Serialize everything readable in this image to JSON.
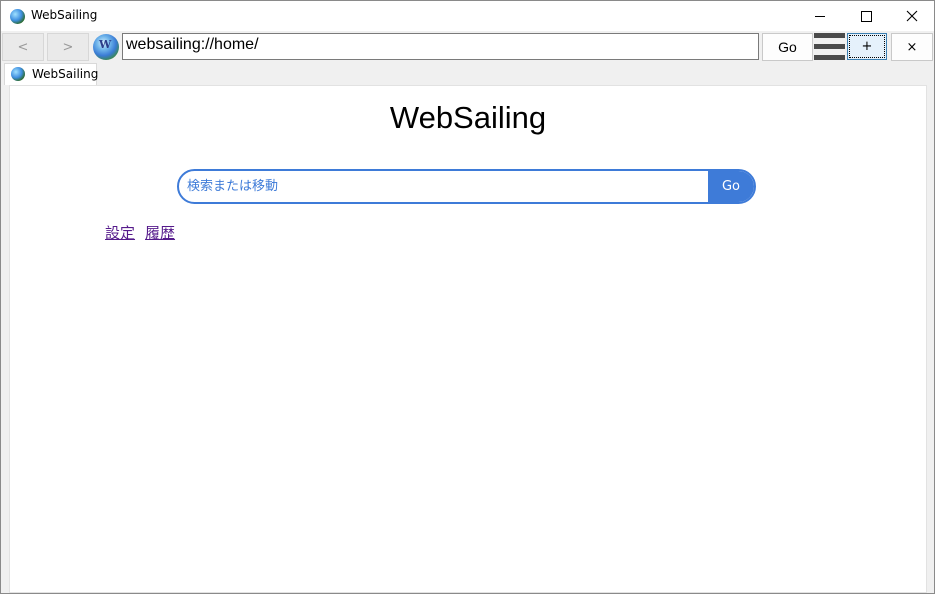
{
  "window": {
    "title": "WebSailing",
    "controls": [
      "minimize",
      "maximize",
      "close"
    ]
  },
  "toolbar": {
    "back_label": "<",
    "forward_label": ">",
    "site_icon_letter": "W",
    "address_value": "websailing://home/",
    "go_label": "Go",
    "menu_icon": "hamburger-icon",
    "new_tab_label": "+",
    "close_tab_label": "×"
  },
  "tabs": [
    {
      "label": "WebSailing",
      "active": true
    }
  ],
  "page": {
    "heading": "WebSailing",
    "search": {
      "placeholder": "検索または移動",
      "button_label": "Go"
    },
    "links": [
      {
        "label": "設定"
      },
      {
        "label": "履歴"
      }
    ]
  },
  "colors": {
    "accent": "#3e7bd8",
    "visited_link": "#551a8b"
  }
}
